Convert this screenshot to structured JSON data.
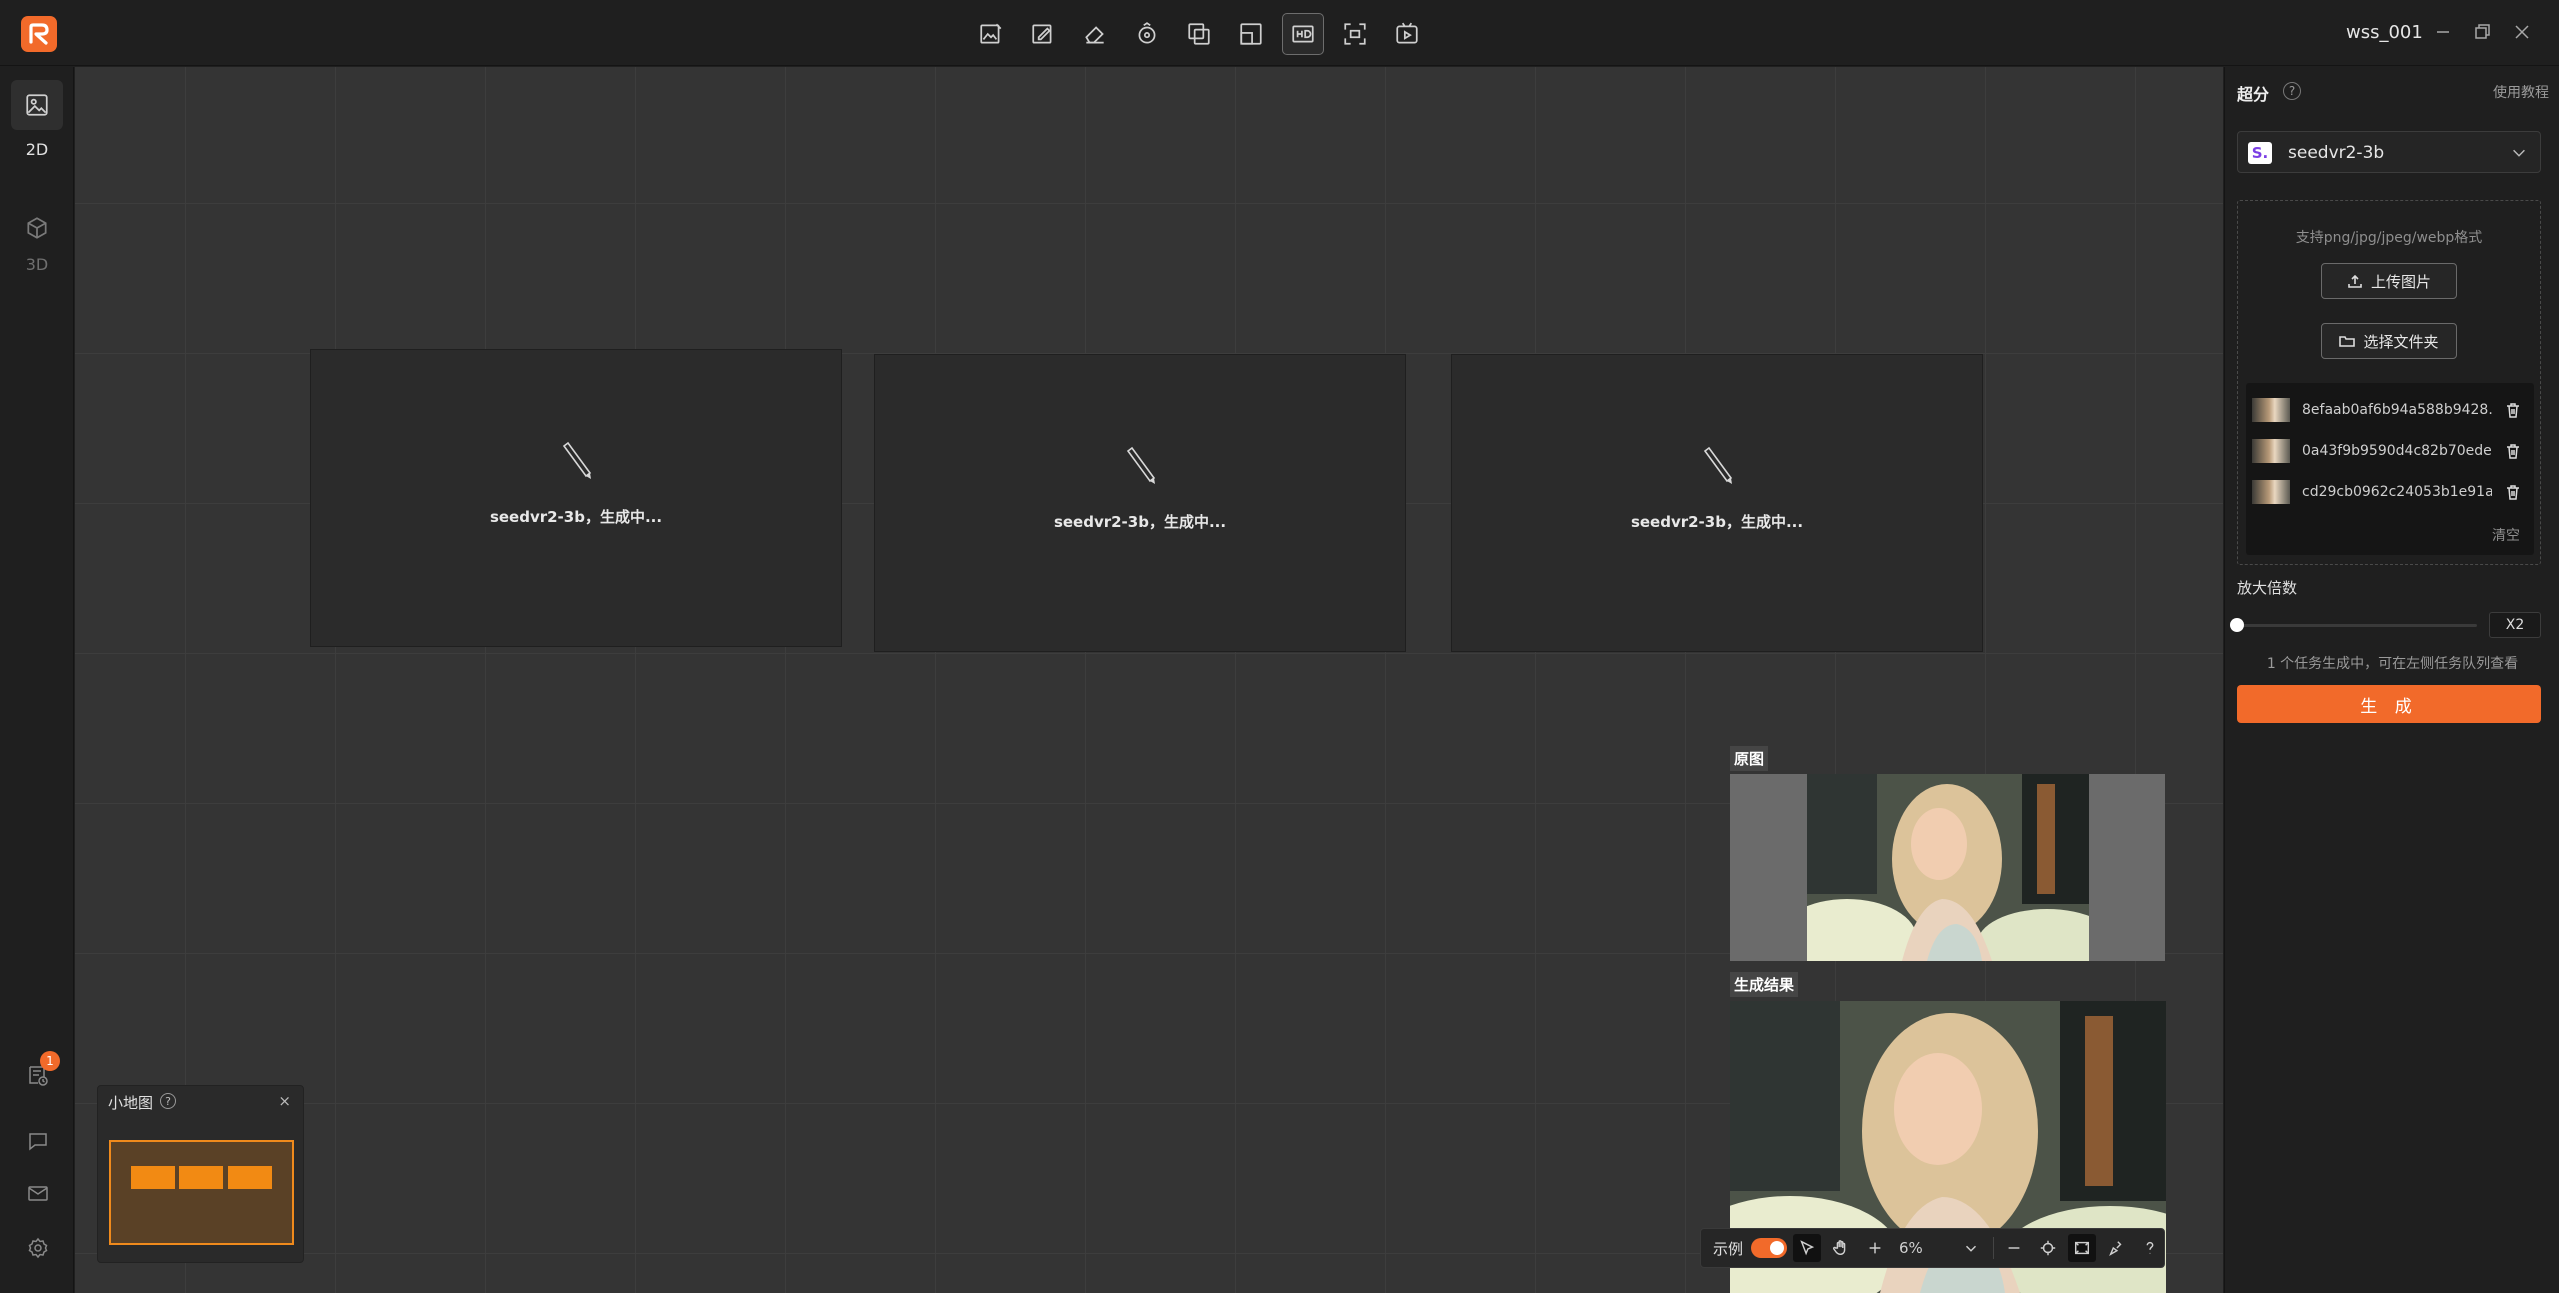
{
  "header": {
    "username": "wss_001",
    "tools": [
      {
        "icon": "image-edit-icon"
      },
      {
        "icon": "image-brush-icon"
      },
      {
        "icon": "eraser-icon"
      },
      {
        "icon": "face-swap-icon"
      },
      {
        "icon": "layers-icon"
      },
      {
        "icon": "expand-icon"
      },
      {
        "icon": "hd-upscale-icon",
        "active": true
      },
      {
        "icon": "crop-frame-icon"
      },
      {
        "icon": "video-play-icon"
      }
    ]
  },
  "left_nav": {
    "items": [
      {
        "label": "2D",
        "icon": "image-icon",
        "active": true
      },
      {
        "label": "3D",
        "icon": "cube-icon",
        "active": false
      }
    ],
    "task_badge": "1"
  },
  "canvas": {
    "cards": [
      {
        "text": "seedvr2-3b，生成中..."
      },
      {
        "text": "seedvr2-3b，生成中..."
      },
      {
        "text": "seedvr2-3b，生成中..."
      }
    ],
    "original_label": "原图",
    "result_label": "生成结果"
  },
  "minimap": {
    "title": "小地图",
    "help": "?",
    "close": "×"
  },
  "bottom_toolbar": {
    "example_label": "示例",
    "zoom": "6%"
  },
  "panel": {
    "title": "超分",
    "help": "?",
    "tutorial": "使用教程",
    "model": {
      "logo": "S.",
      "name": "seedvr2-3b"
    },
    "upload_hint": "支持png/jpg/jpeg/webp格式",
    "upload_button": "上传图片",
    "folder_button": "选择文件夹",
    "files": [
      {
        "name": "8efaab0af6b94a588b9428..."
      },
      {
        "name": "0a43f9b9590d4c82b70ede..."
      },
      {
        "name": "cd29cb0962c24053b1e91a..."
      }
    ],
    "clear": "清空",
    "scale_label": "放大倍数",
    "scale_value": "X2",
    "scale_level": 0,
    "task_info": "1 个任务生成中，可在左侧任务队列查看",
    "generate_button": "生 成"
  },
  "colors": {
    "accent": "#f26a2a",
    "canvas_bg": "#343434",
    "panel_bg": "#1f1f1f"
  }
}
